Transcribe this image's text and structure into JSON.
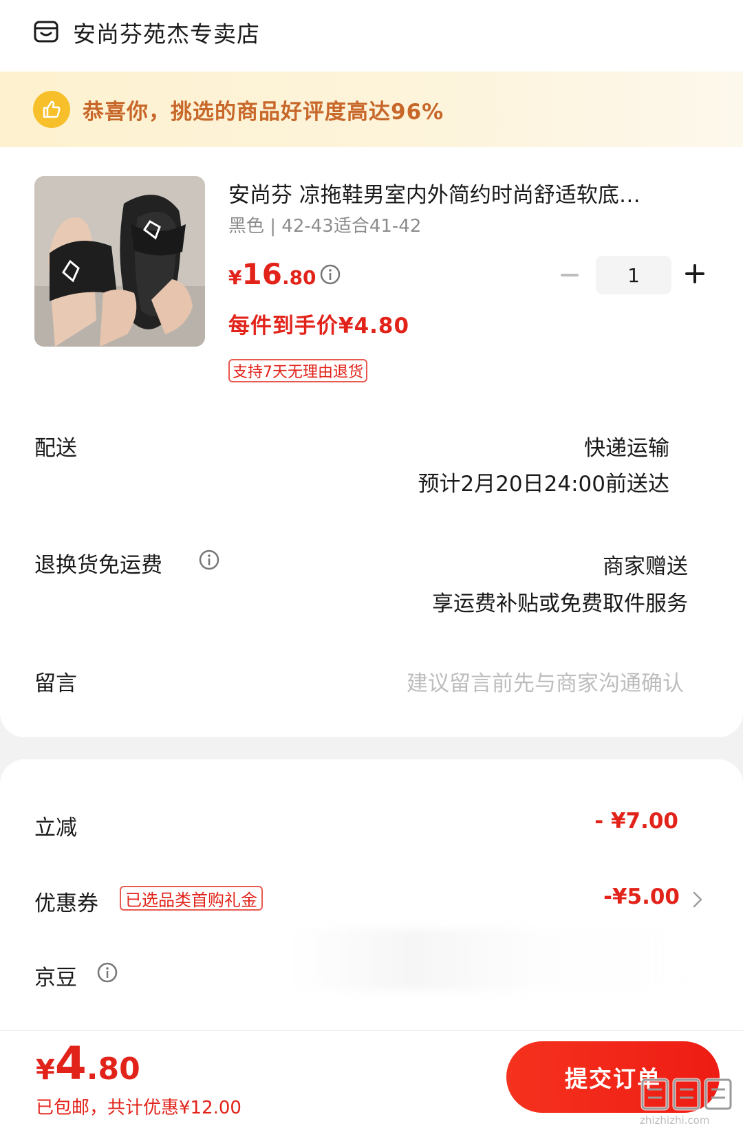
{
  "store": {
    "name": "安尚芬苑杰专卖店",
    "icon": "store-icon"
  },
  "banner": {
    "text": "恭喜你，挑选的商品好评度高达96%",
    "icon": "thumbs-up-icon"
  },
  "product": {
    "title": "安尚芬 凉拖鞋男室内外简约时尚舒适软底…",
    "spec": "黑色 | 42-43适合41-42",
    "price_symbol": "¥",
    "price_int": "16",
    "price_dec": ".80",
    "quantity": "1",
    "unit_price": "每件到手价¥4.80",
    "return_policy": "支持7天无理由退货"
  },
  "delivery": {
    "label": "配送",
    "method": "快递运输",
    "eta": "预计2月20日24:00前送达"
  },
  "return_shipping": {
    "label": "退换货免运费",
    "value": "商家赠送",
    "detail": "享运费补贴或免费取件服务"
  },
  "message": {
    "label": "留言",
    "placeholder": "建议留言前先与商家沟通确认"
  },
  "discounts": {
    "instant_label": "立减",
    "instant_value": "- ¥7.00",
    "coupon_label": "优惠券",
    "coupon_tag": "已选品类首购礼金",
    "coupon_value": "-¥5.00",
    "beans_label": "京豆"
  },
  "footer": {
    "total_symbol": "¥",
    "total_int": "4",
    "total_dec": ".80",
    "note": "已包邮，共计优惠¥12.00",
    "submit_label": "提交订单",
    "watermark": "zhizhizhi.com"
  },
  "colors": {
    "accent_red": "#e2231a",
    "banner_text": "#c8672a",
    "banner_bg": "#fdf1cf"
  }
}
